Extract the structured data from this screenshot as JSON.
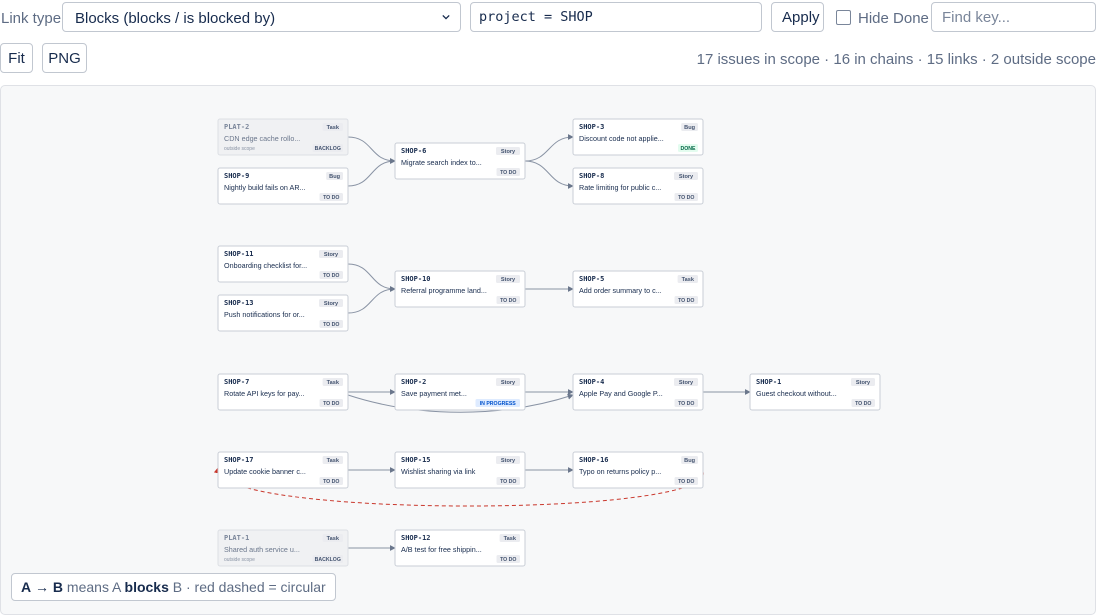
{
  "toolbar": {
    "link_type_label": "Link type",
    "link_type_value": "Blocks (blocks / is blocked by)",
    "jql_value": "project = SHOP",
    "apply_label": "Apply",
    "hide_done_label": "Hide Done",
    "hide_done_checked": false,
    "find_placeholder": "Find key...",
    "fit_label": "Fit",
    "png_label": "PNG",
    "summary": "17 issues in scope · 16 in chains · 15 links · 2 outside scope"
  },
  "legend": {
    "a": "A",
    "arrow": "→",
    "b": "B",
    "means": "means A",
    "blocks": "blocks",
    "rest": "B · red dashed = circular"
  },
  "colors": {
    "done_bg": "#e3fcef",
    "done_fg": "#006644",
    "todo_bg": "#ebecf0",
    "todo_fg": "#42526e",
    "progress_bg": "#deebff",
    "progress_fg": "#0052cc",
    "circular": "#c9372c"
  },
  "nodes": [
    {
      "id": "PLAT-2",
      "type": "Task",
      "title": "CDN edge cache rollo...",
      "status": "BACKLOG",
      "note": "outside scope",
      "outside": true
    },
    {
      "id": "SHOP-9",
      "type": "Bug",
      "title": "Nightly build fails on AR...",
      "status": "TO DO"
    },
    {
      "id": "SHOP-6",
      "type": "Story",
      "title": "Migrate search index to...",
      "status": "TO DO"
    },
    {
      "id": "SHOP-3",
      "type": "Bug",
      "title": "Discount code not applie...",
      "status": "DONE"
    },
    {
      "id": "SHOP-8",
      "type": "Story",
      "title": "Rate limiting for public c...",
      "status": "TO DO"
    },
    {
      "id": "SHOP-11",
      "type": "Story",
      "title": "Onboarding checklist for...",
      "status": "TO DO"
    },
    {
      "id": "SHOP-13",
      "type": "Story",
      "title": "Push notifications for or...",
      "status": "TO DO"
    },
    {
      "id": "SHOP-10",
      "type": "Story",
      "title": "Referral programme land...",
      "status": "TO DO"
    },
    {
      "id": "SHOP-5",
      "type": "Task",
      "title": "Add order summary to c...",
      "status": "TO DO"
    },
    {
      "id": "SHOP-7",
      "type": "Task",
      "title": "Rotate API keys for pay...",
      "status": "TO DO"
    },
    {
      "id": "SHOP-2",
      "type": "Story",
      "title": "Save payment met...",
      "status": "IN PROGRESS"
    },
    {
      "id": "SHOP-4",
      "type": "Story",
      "title": "Apple Pay and Google P...",
      "status": "TO DO"
    },
    {
      "id": "SHOP-1",
      "type": "Story",
      "title": "Guest checkout without...",
      "status": "TO DO"
    },
    {
      "id": "SHOP-17",
      "type": "Task",
      "title": "Update cookie banner c...",
      "status": "TO DO"
    },
    {
      "id": "SHOP-15",
      "type": "Story",
      "title": "Wishlist sharing via link",
      "status": "TO DO"
    },
    {
      "id": "SHOP-16",
      "type": "Bug",
      "title": "Typo on returns policy p...",
      "status": "TO DO"
    },
    {
      "id": "PLAT-1",
      "type": "Task",
      "title": "Shared auth service u...",
      "status": "BACKLOG",
      "note": "outside scope",
      "outside": true
    },
    {
      "id": "SHOP-12",
      "type": "Task",
      "title": "A/B test for free shippin...",
      "status": "TO DO"
    }
  ],
  "links": [
    {
      "from": "PLAT-2",
      "to": "SHOP-6"
    },
    {
      "from": "SHOP-9",
      "to": "SHOP-6"
    },
    {
      "from": "SHOP-6",
      "to": "SHOP-3"
    },
    {
      "from": "SHOP-6",
      "to": "SHOP-8"
    },
    {
      "from": "SHOP-11",
      "to": "SHOP-10"
    },
    {
      "from": "SHOP-13",
      "to": "SHOP-10"
    },
    {
      "from": "SHOP-10",
      "to": "SHOP-5"
    },
    {
      "from": "SHOP-7",
      "to": "SHOP-2"
    },
    {
      "from": "SHOP-7",
      "to": "SHOP-4"
    },
    {
      "from": "SHOP-2",
      "to": "SHOP-4"
    },
    {
      "from": "SHOP-4",
      "to": "SHOP-1"
    },
    {
      "from": "SHOP-17",
      "to": "SHOP-15"
    },
    {
      "from": "SHOP-15",
      "to": "SHOP-16"
    },
    {
      "from": "SHOP-16",
      "to": "SHOP-17",
      "circular": true
    },
    {
      "from": "PLAT-1",
      "to": "SHOP-12"
    }
  ]
}
